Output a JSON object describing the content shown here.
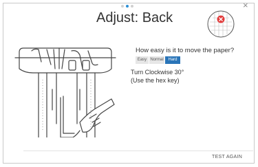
{
  "dialog": {
    "title": "Adjust: Back",
    "close_symbol": "×",
    "page_indicator": {
      "count": 3,
      "current": 2
    }
  },
  "question": {
    "text": "How easy is it to move the paper?",
    "options": [
      "Easy",
      "Normal",
      "Hard"
    ],
    "selected": "Hard"
  },
  "instruction": {
    "line1": "Turn Clockwise 30°",
    "line2": "(Use the hex key)"
  },
  "footer": {
    "test_again_label": "TEST AGAIN"
  },
  "icons": {
    "target": "alignment-target-icon",
    "illustration": "print-head-hex-key-illustration"
  },
  "colors": {
    "accent": "#2a75b8",
    "target_mark": "#e23b3b"
  }
}
